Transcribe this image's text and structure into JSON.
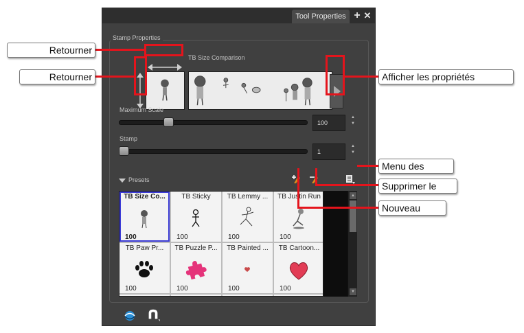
{
  "panel": {
    "tab_title": "Tool Properties",
    "group_title": "Stamp Properties",
    "comparison_label": "TB Size Comparison",
    "max_scale_label": "Maximum Scale",
    "max_scale_value": "100",
    "max_scale_fraction": 0.25,
    "stamp_label": "Stamp",
    "stamp_value": "1",
    "stamp_fraction": 0.0,
    "presets_label": "Presets"
  },
  "presets": [
    {
      "name": "TB Size Co...",
      "value": "100",
      "selected": true,
      "icon": "girl-figure-icon"
    },
    {
      "name": "TB Sticky",
      "value": "100",
      "selected": false,
      "icon": "stick-figure-icon"
    },
    {
      "name": "TB Lemmy ...",
      "value": "100",
      "selected": false,
      "icon": "running-figure-icon"
    },
    {
      "name": "TB Justin Run",
      "value": "100",
      "selected": false,
      "icon": "justin-run-icon"
    },
    {
      "name": "TB Paw Pr...",
      "value": "100",
      "selected": false,
      "icon": "paw-print-icon"
    },
    {
      "name": "TB Puzzle P...",
      "value": "100",
      "selected": false,
      "icon": "puzzle-piece-icon"
    },
    {
      "name": "TB Painted ...",
      "value": "100",
      "selected": false,
      "icon": "painted-heart-icon"
    },
    {
      "name": "TB Cartoon...",
      "value": "100",
      "selected": false,
      "icon": "cartoon-heart-icon"
    }
  ],
  "callouts": {
    "flip_horizontal": "Retourner",
    "flip_vertical": "Retourner",
    "show_properties": "Afficher les propriétés",
    "menu": "Menu des",
    "delete": "Supprimer le",
    "new": "Nouveau"
  },
  "colors": {
    "accent_red": "#e4141c",
    "selection_blue": "#3b3bd6",
    "panel_bg": "#404040"
  }
}
